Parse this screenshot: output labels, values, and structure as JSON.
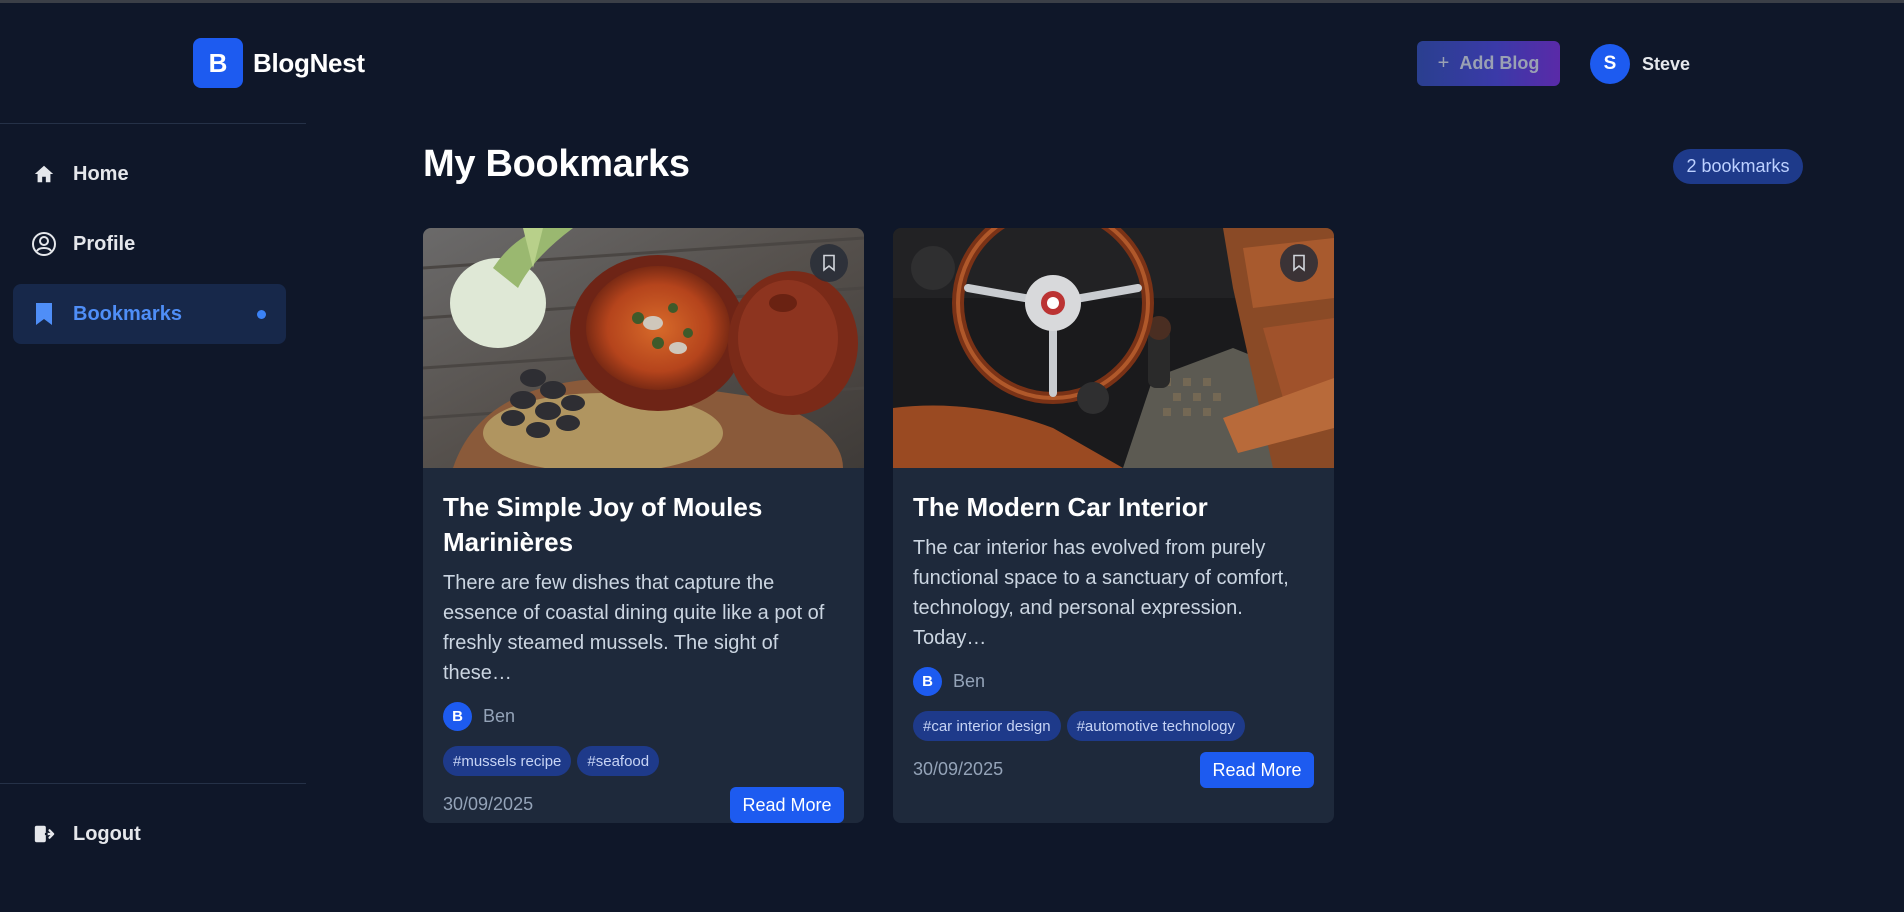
{
  "app": {
    "brand_letter": "B",
    "brand_name": "BlogNest"
  },
  "header": {
    "add_blog_label": "Add Blog",
    "user": {
      "initial": "S",
      "name": "Steve"
    }
  },
  "sidebar": {
    "items": [
      {
        "label": "Home",
        "icon": "home-icon"
      },
      {
        "label": "Profile",
        "icon": "user-circle-icon"
      },
      {
        "label": "Bookmarks",
        "icon": "bookmark-icon",
        "active": true
      }
    ],
    "logout_label": "Logout"
  },
  "main": {
    "title": "My Bookmarks",
    "count_label": "2 bookmarks",
    "cards": [
      {
        "title": "The Simple Joy of Moules Marinières",
        "excerpt": "There are few dishes that capture the essence of coastal dining quite like a pot of freshly steamed mussels. The sight of these…",
        "author_initial": "B",
        "author": "Ben",
        "tags": [
          "#mussels recipe",
          "#seafood"
        ],
        "date": "30/09/2025",
        "read_more": "Read More"
      },
      {
        "title": "The Modern Car Interior",
        "excerpt": "The car interior has evolved from purely functional space to a sanctuary of comfort, technology, and personal expression. Today…",
        "author_initial": "B",
        "author": "Ben",
        "tags": [
          "#car interior design",
          "#automotive technology"
        ],
        "date": "30/09/2025",
        "read_more": "Read More"
      }
    ]
  },
  "colors": {
    "background": "#0f1729",
    "card": "#1e293b",
    "accent": "#1d5bf0",
    "tag_bg": "#1e3a8a"
  }
}
